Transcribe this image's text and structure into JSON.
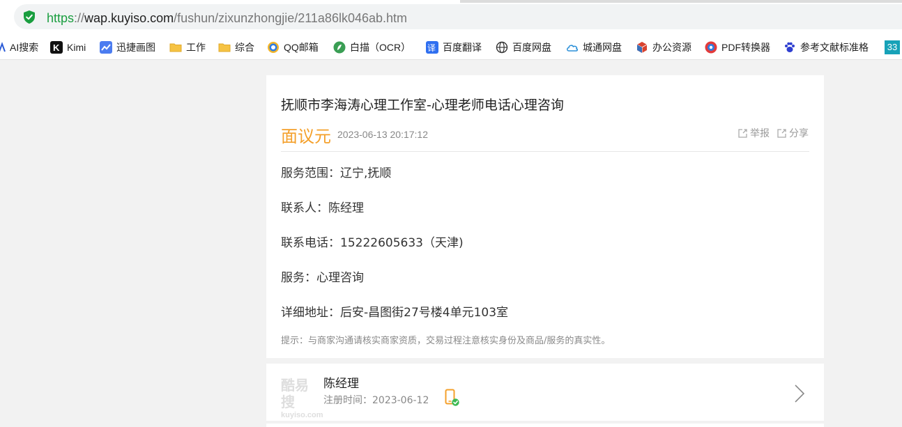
{
  "browser": {
    "url": {
      "scheme": "https",
      "separator": "://",
      "host": "wap.kuyiso.com",
      "path": "/fushun/zixunzhongjie/211a86lk046ab.htm"
    },
    "bookmarks": [
      {
        "label": "AI搜索",
        "icon": "ai-search-icon"
      },
      {
        "label": "Kimi",
        "icon": "kimi-icon"
      },
      {
        "label": "迅捷画图",
        "icon": "xunjie-draw-icon"
      },
      {
        "label": "工作",
        "icon": "folder-icon"
      },
      {
        "label": "综合",
        "icon": "folder-icon"
      },
      {
        "label": "QQ邮箱",
        "icon": "qq-mail-icon"
      },
      {
        "label": "白描（OCR）",
        "icon": "baimiao-icon"
      },
      {
        "label": "百度翻译",
        "icon": "baidu-translate-icon"
      },
      {
        "label": "百度网盘",
        "icon": "globe-icon"
      },
      {
        "label": "城通网盘",
        "icon": "cloud-icon"
      },
      {
        "label": "办公资源",
        "icon": "office-cube-icon"
      },
      {
        "label": "PDF转换器",
        "icon": "pdf-converter-icon"
      },
      {
        "label": "参考文献标准格",
        "icon": "baidu-paw-icon"
      },
      {
        "label": "33",
        "icon": "badge-icon"
      }
    ]
  },
  "listing": {
    "title": "抚顺市李海涛心理工作室-心理老师电话心理咨询",
    "price": "面议元",
    "posted": "2023-06-13 20:17:12",
    "report_label": "举报",
    "share_label": "分享",
    "fields": [
      {
        "text": "服务范围：辽宁,抚顺"
      },
      {
        "text": "联系人：陈经理"
      },
      {
        "text": "联系电话：15222605633（天津)"
      },
      {
        "text": "服务：心理咨询"
      },
      {
        "text": "详细地址：后安-昌图街27号楼4单元103室"
      }
    ],
    "tip": "提示：与商家沟通请核实商家资质，交易过程注意核实身份及商品/服务的真实性。"
  },
  "seller": {
    "logo_text": "酷易搜",
    "logo_domain": "kuyiso.com",
    "name": "陈经理",
    "registered": "注册时间：2023-06-12"
  },
  "colors": {
    "price": "#f4a02b",
    "scheme_green": "#1a9e3f",
    "page_bg": "#f2f2f2"
  }
}
